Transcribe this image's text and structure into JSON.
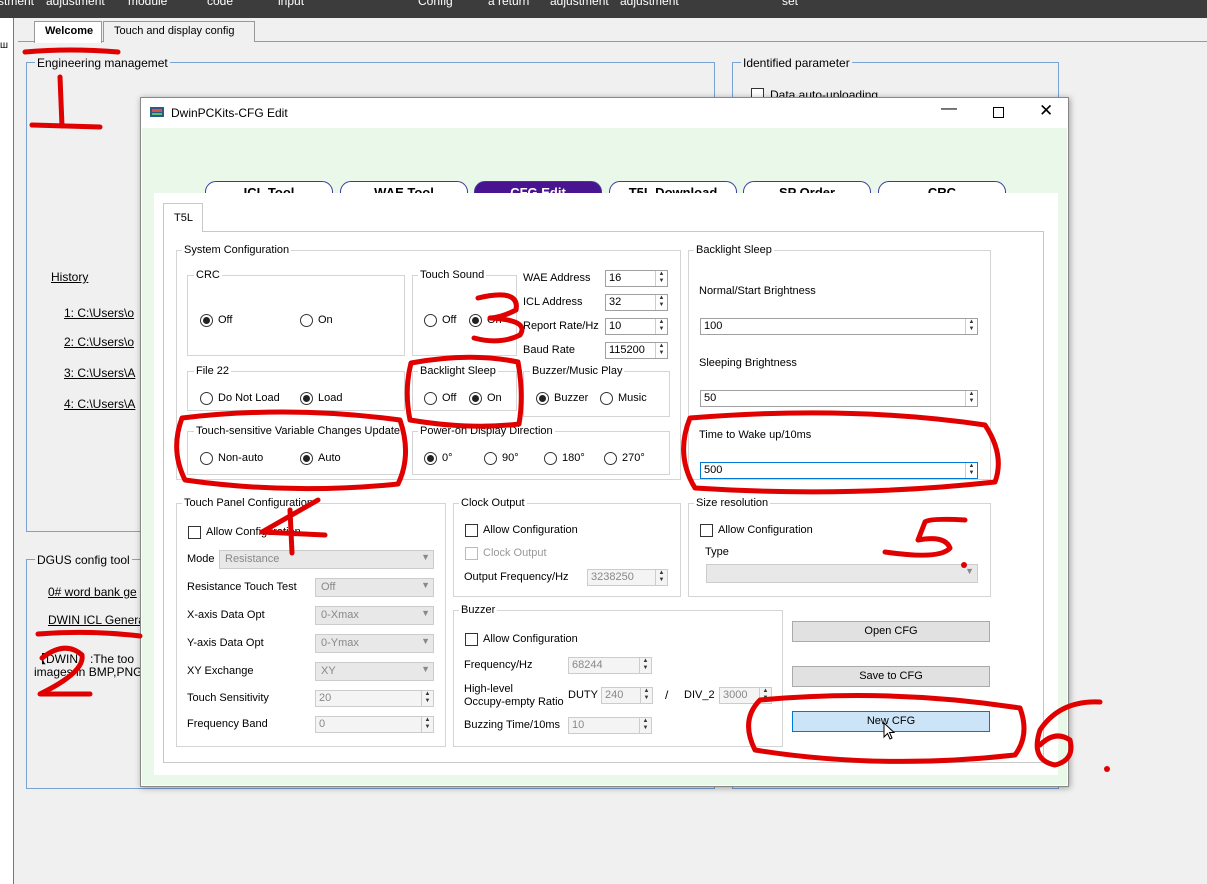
{
  "menubar": {
    "items": [
      "stment",
      "adjustment",
      "module",
      "code",
      "input",
      "Config",
      "a return",
      "adjustment",
      "adjustment",
      "set"
    ]
  },
  "left_strip_glyph": "ш",
  "outer_tabs": [
    "Welcome",
    "Touch and display config"
  ],
  "engineering": {
    "title": "Engineering managemet",
    "history_label": "History",
    "history_items": [
      "1:  C:\\Users\\o",
      "2:  C:\\Users\\o",
      "3:  C:\\Users\\A",
      "4:  C:\\Users\\A"
    ]
  },
  "identified": {
    "title": "Identified parameter",
    "auto_upload": "Data auto-uploading"
  },
  "dgus": {
    "title": "DGUS config tool",
    "links": [
      "0# word bank ge",
      "DWIN ICL Genera"
    ],
    "note_line1": "【DWIN】:The too",
    "note_line2": "images in BMP,PNG"
  },
  "dialog": {
    "title": "DwinPCKits-CFG Edit",
    "nav": [
      "ICL Tool",
      "WAE Tool",
      "CFG Edit",
      "T5L Download",
      "SP Order",
      "CRC"
    ],
    "tab": "T5L",
    "system_config": {
      "title": "System Configuration",
      "crc": {
        "title": "CRC",
        "off": "Off",
        "on": "On",
        "selected": "Off"
      },
      "touch_sound": {
        "title": "Touch Sound",
        "off": "Off",
        "on": "On",
        "selected": "On"
      },
      "wae_address": {
        "label": "WAE Address",
        "value": "16"
      },
      "icl_address": {
        "label": "ICL Address",
        "value": "32"
      },
      "report_rate": {
        "label": "Report Rate/Hz",
        "value": "10"
      },
      "baud_rate": {
        "label": "Baud Rate",
        "value": "115200"
      },
      "file22": {
        "title": "File 22",
        "opt1": "Do Not Load",
        "opt2": "Load",
        "selected": "Load"
      },
      "backlight_sleep": {
        "title": "Backlight Sleep",
        "off": "Off",
        "on": "On",
        "selected": "On"
      },
      "buzzer_music": {
        "title": "Buzzer/Music Play",
        "opt1": "Buzzer",
        "opt2": "Music",
        "selected": "Buzzer"
      },
      "touch_var": {
        "title": "Touch-sensitive Variable Changes Update",
        "opt1": "Non-auto",
        "opt2": "Auto",
        "selected": "Auto"
      },
      "power_dir": {
        "title": "Power-on Display Direction",
        "opts": [
          "0°",
          "90°",
          "180°",
          "270°"
        ],
        "selected": "0°"
      }
    },
    "backlight": {
      "title": "Backlight Sleep",
      "normal_label": "Normal/Start Brightness",
      "normal_value": "100",
      "sleeping_label": "Sleeping Brightness",
      "sleeping_value": "50",
      "wake_label": "Time to Wake up/10ms",
      "wake_value": "500"
    },
    "touch_panel": {
      "title": "Touch Panel Configuration",
      "allow": "Allow Configuration",
      "mode_label": "Mode",
      "mode_value": "Resistance",
      "rows": [
        {
          "label": "Resistance Touch Test",
          "value": "Off"
        },
        {
          "label": "X-axis Data Opt",
          "value": "0-Xmax"
        },
        {
          "label": "Y-axis Data Opt",
          "value": "0-Ymax"
        },
        {
          "label": "XY Exchange",
          "value": "XY"
        },
        {
          "label": "Touch Sensitivity",
          "value": "20"
        },
        {
          "label": "Frequency Band",
          "value": "0"
        }
      ]
    },
    "clock_output": {
      "title": "Clock Output",
      "allow": "Allow Configuration",
      "clock": "Clock Output",
      "freq_label": "Output Frequency/Hz",
      "freq_value": "3238250"
    },
    "size_resolution": {
      "title": "Size resolution",
      "allow": "Allow Configuration",
      "type_label": "Type"
    },
    "buzzer": {
      "title": "Buzzer",
      "allow": "Allow Configuration",
      "freq_label": "Frequency/Hz",
      "freq_value": "68244",
      "hl_label1": "High-level",
      "hl_label2": "Occupy-empty Ratio",
      "duty_label": "DUTY",
      "duty_value": "240",
      "slash": "/",
      "div_label": "DIV_2",
      "div_value": "3000",
      "time_label": "Buzzing Time/10ms",
      "time_value": "10"
    },
    "buttons": {
      "open": "Open CFG",
      "save": "Save to CFG",
      "new": "New CFG"
    }
  },
  "annotations": {
    "color": "#e00000",
    "numbers": [
      "1",
      "2",
      "3",
      "4",
      "5.",
      "6."
    ]
  }
}
